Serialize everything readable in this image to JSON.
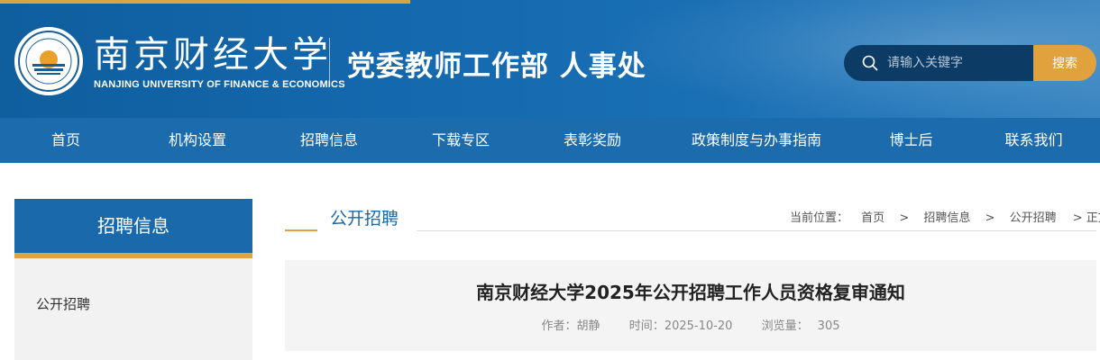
{
  "header": {
    "logo_cn": "南京财经大学",
    "logo_en": "NANJING UNIVERSITY OF FINANCE & ECONOMICS",
    "dept_title": "党委教师工作部 人事处",
    "search_placeholder": "请输入关键字",
    "search_button": "搜索"
  },
  "nav": [
    {
      "label": "首页"
    },
    {
      "label": "机构设置"
    },
    {
      "label": "招聘信息"
    },
    {
      "label": "下载专区"
    },
    {
      "label": "表彰奖励"
    },
    {
      "label": "政策制度与办事指南"
    },
    {
      "label": "博士后"
    },
    {
      "label": "联系我们"
    }
  ],
  "sidebar": {
    "title": "招聘信息",
    "items": [
      {
        "label": "公开招聘"
      }
    ]
  },
  "main": {
    "section_title": "公开招聘",
    "breadcrumb": {
      "prefix": "当前位置：",
      "items": [
        "首页",
        "招聘信息",
        "公开招聘"
      ],
      "current": "> 正文"
    },
    "article": {
      "title": "南京财经大学2025年公开招聘工作人员资格复审通知",
      "author_label": "作者：",
      "author": "胡静",
      "time_label": "时间：",
      "time": "2025-10-20",
      "views_label": "浏览量：",
      "views": "305"
    }
  },
  "colors": {
    "primary_blue": "#1a69ab",
    "accent_gold": "#d9a441",
    "search_bg": "#0c3c66"
  }
}
